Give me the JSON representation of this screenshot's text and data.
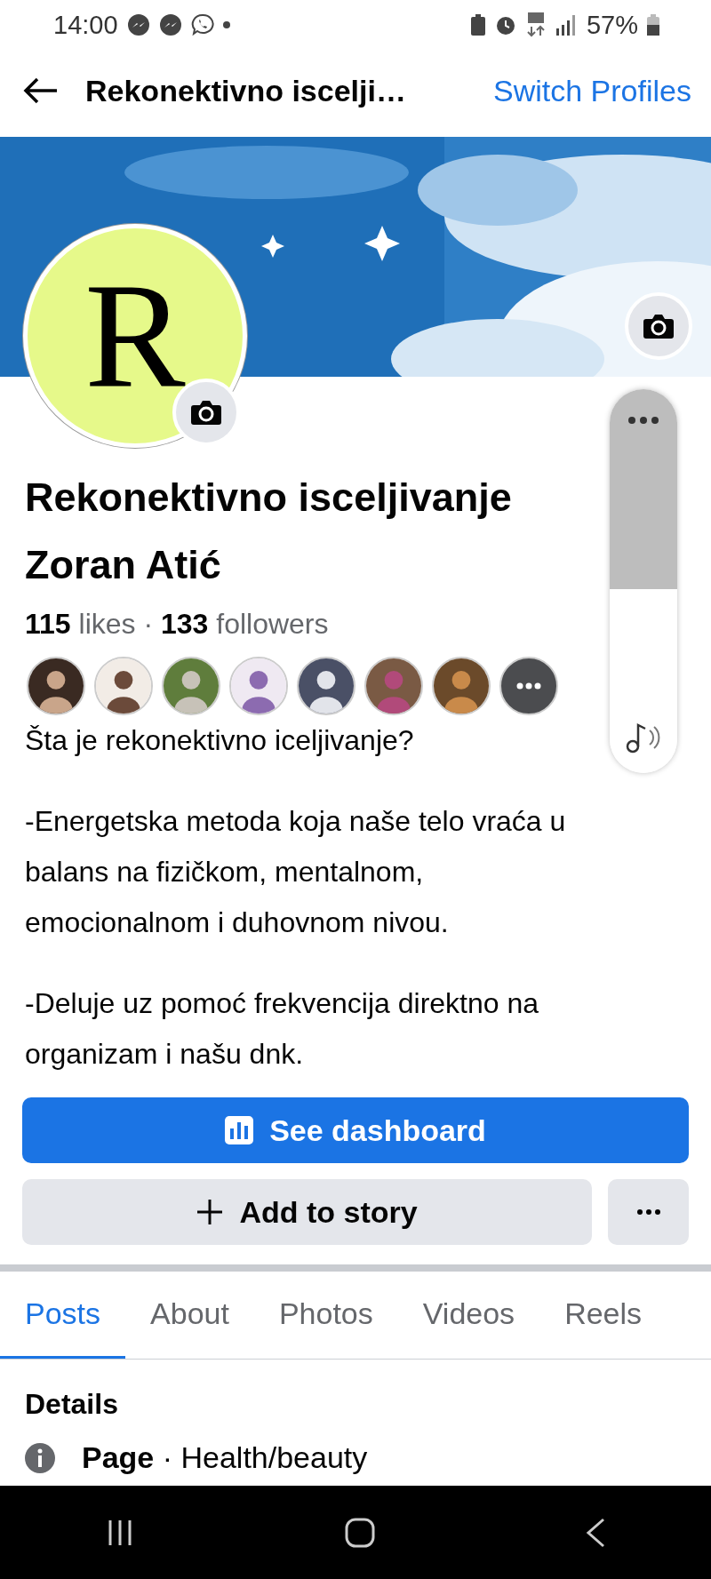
{
  "status_bar": {
    "time": "14:00",
    "battery": "57%"
  },
  "header": {
    "title": "Rekonektivno iscelji…",
    "action": "Switch Profiles"
  },
  "cover": {
    "kind": "picture"
  },
  "avatar": {
    "letter": "R"
  },
  "page_name": "Rekonektivno isceljivanje Zoran Atić",
  "stats": "**115** likes · **133** followers",
  "follower_photos": [
    {
      "kind": "picture"
    },
    {
      "kind": "picture"
    },
    {
      "kind": "picture"
    },
    {
      "kind": "picture"
    },
    {
      "kind": "picture"
    },
    {
      "kind": "picture"
    },
    {
      "kind": "picture"
    },
    {
      "kind": "more"
    }
  ],
  "description": [
    "Šta je rekonektivno iceljivanje?",
    "-Energetska metoda koja naše telo vraća u balans na fizičkom, mentalnom, emocionalnom i duhovnom nivou.",
    "-Deluje uz pomoć frekvencija direktno na organizam i našu dnk."
  ],
  "buttons": {
    "dashboard": "See dashboard",
    "story": "Add to story"
  },
  "tabs": [
    {
      "label": "Posts",
      "selected": true
    },
    {
      "label": "About",
      "selected": false
    },
    {
      "label": "Photos",
      "selected": false
    },
    {
      "label": "Videos",
      "selected": false
    },
    {
      "label": "Reels",
      "selected": false
    }
  ],
  "details": {
    "heading": "Details",
    "items": [
      {
        "text": "**Page** · Health/beauty"
      }
    ]
  },
  "volume_panel": {
    "level": 0.45
  }
}
